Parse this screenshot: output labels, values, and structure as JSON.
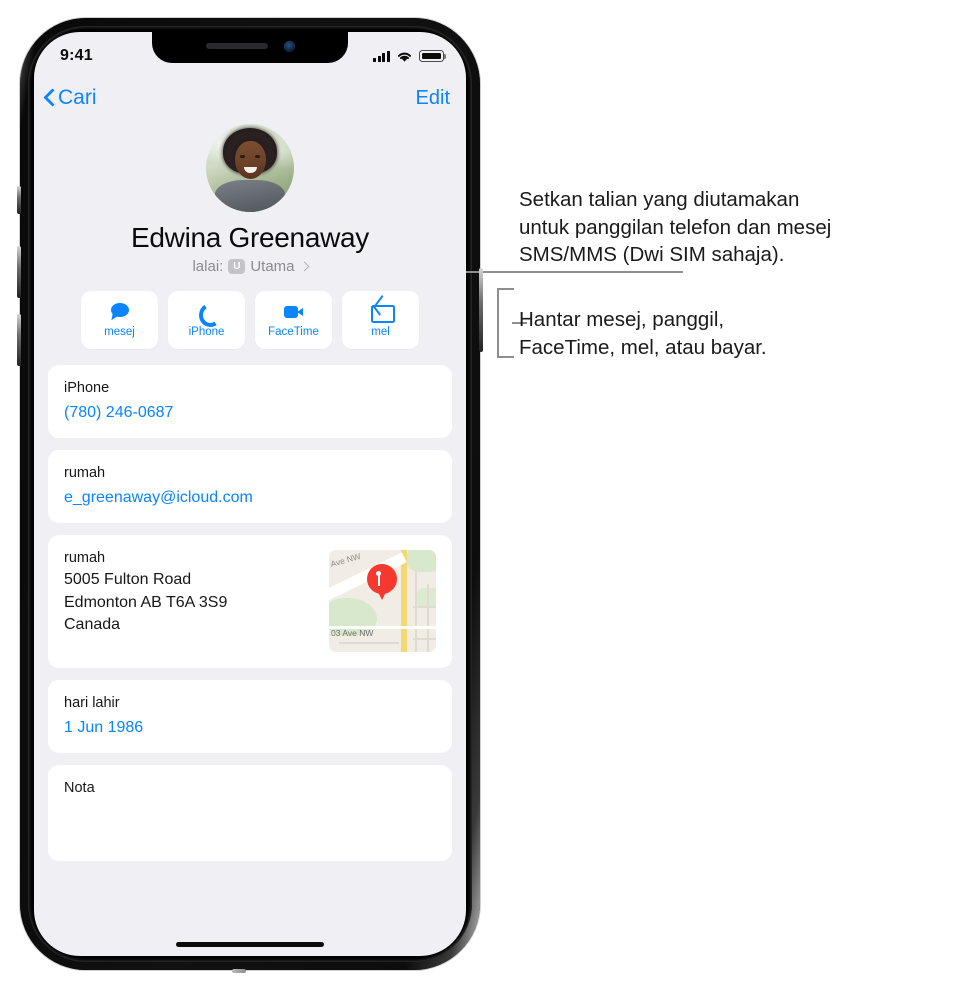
{
  "status_bar": {
    "time": "9:41",
    "cellular_icon": "signal-bars-icon",
    "wifi_icon": "wifi-icon",
    "battery_icon": "battery-icon"
  },
  "nav_bar": {
    "back_label": "Cari",
    "back_icon": "chevron-left-icon",
    "edit_label": "Edit"
  },
  "contact": {
    "avatar_icon": "contact-avatar-photo",
    "name": "Edwina Greenaway",
    "default_line_prefix": "lalai:",
    "default_badge": "U",
    "default_value": "Utama",
    "default_chevron_icon": "chevron-right-icon"
  },
  "actions": [
    {
      "label": "mesej",
      "icon": "message-bubble-icon"
    },
    {
      "label": "iPhone",
      "icon": "phone-handset-icon"
    },
    {
      "label": "FaceTime",
      "icon": "video-camera-icon"
    },
    {
      "label": "mel",
      "icon": "envelope-icon"
    }
  ],
  "cards": {
    "phone": {
      "label": "iPhone",
      "value": "(780) 246-0687"
    },
    "email": {
      "label": "rumah",
      "value": "e_greenaway@icloud.com"
    },
    "address": {
      "label": "rumah",
      "line1": "5005 Fulton Road",
      "line2": "Edmonton AB T6A 3S9",
      "line3": "Canada",
      "map_icon": "map-thumbnail",
      "map_pin_icon": "map-pin-icon",
      "map_label_top": "Ave NW",
      "map_label_bottom": "03 Ave NW"
    },
    "birthday": {
      "label": "hari lahir",
      "value": "1 Jun 1986"
    },
    "notes": {
      "label": "Nota"
    }
  },
  "callouts": {
    "one": "Setkan talian yang diutamakan\nuntuk panggilan telefon dan mesej\nSMS/MMS (Dwi SIM sahaja).",
    "two": "Hantar mesej, panggil,\nFaceTime, mel, atau bayar."
  },
  "colors": {
    "accent_blue": "#0a84ff",
    "screen_bg": "#f0f0f4",
    "card_bg": "#ffffff",
    "label_grey": "#8b8b90",
    "pin_red": "#f5392e"
  }
}
